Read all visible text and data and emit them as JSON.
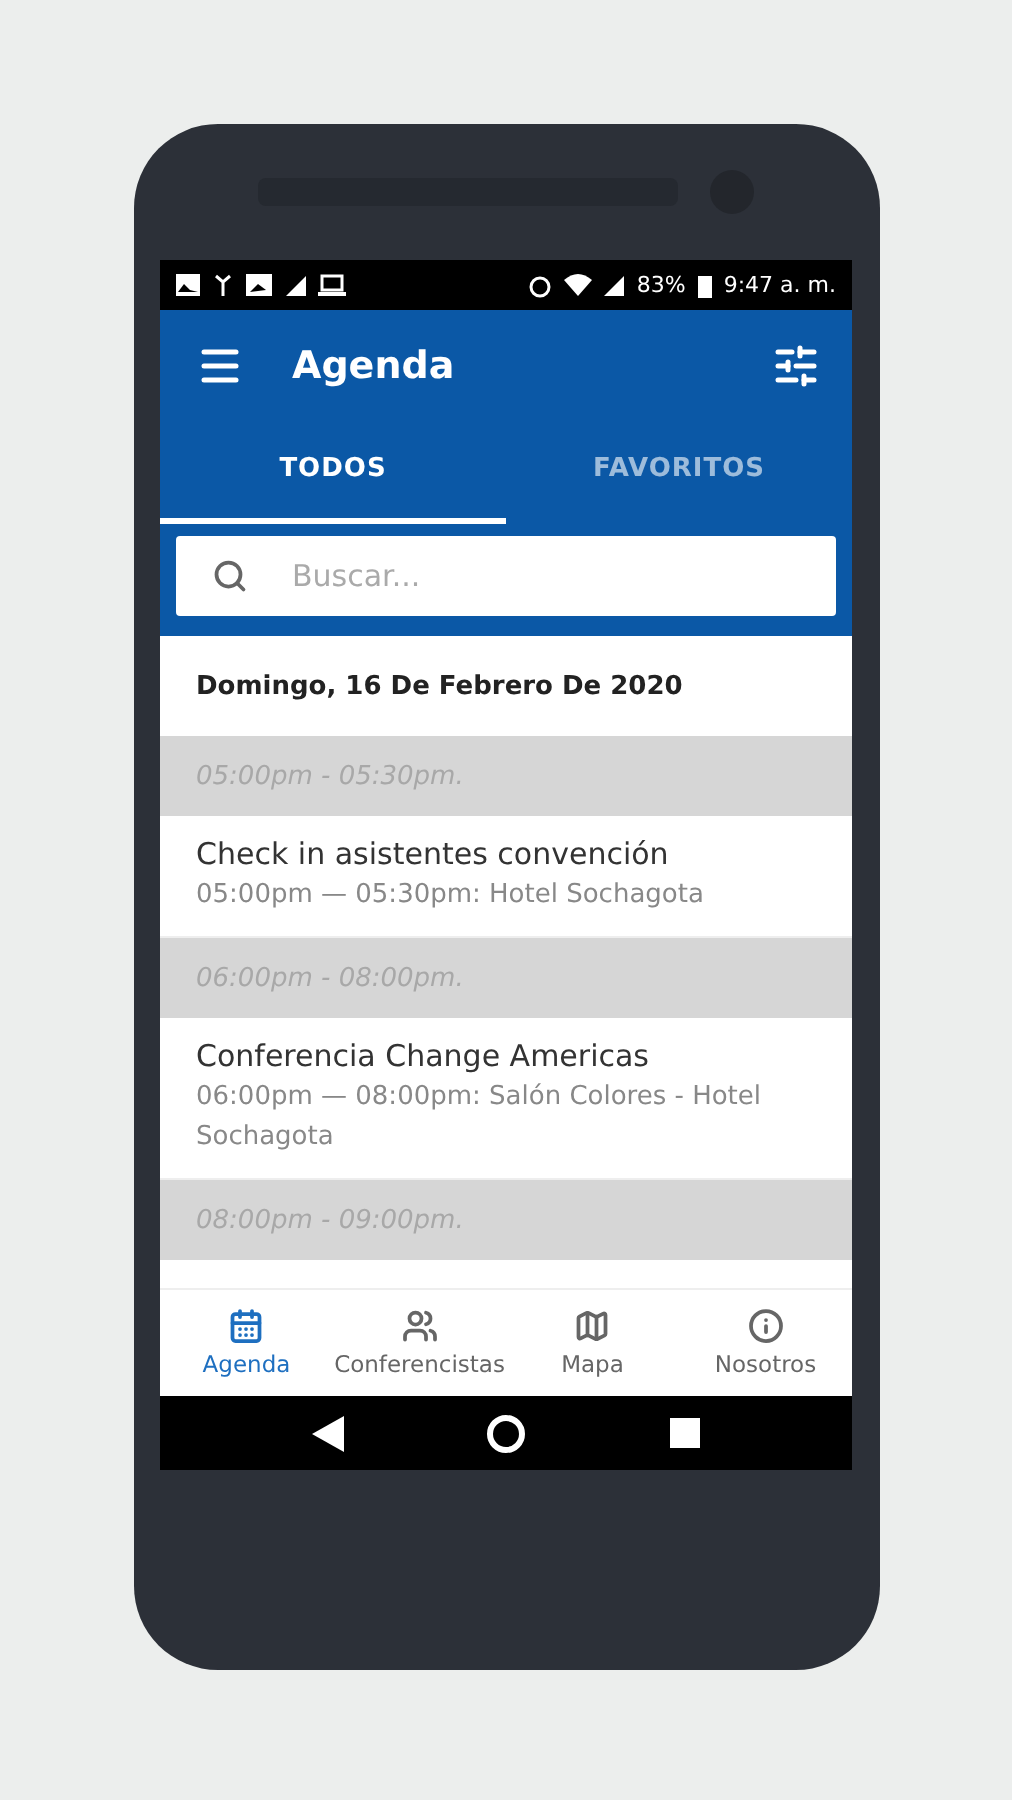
{
  "status_bar": {
    "battery": "83%",
    "time": "9:47 a. m."
  },
  "app_bar": {
    "title": "Agenda"
  },
  "tabs": [
    {
      "label": "TODOS",
      "selected": true
    },
    {
      "label": "FAVORITOS",
      "selected": false
    }
  ],
  "search": {
    "placeholder": "Buscar..."
  },
  "date": "Domingo, 16 De Febrero De 2020",
  "agenda": [
    {
      "kind": "time_header",
      "text": "05:00pm - 05:30pm."
    },
    {
      "kind": "event",
      "title": "Check in asistentes convención",
      "detail": "05:00pm — 05:30pm: Hotel Sochagota"
    },
    {
      "kind": "time_header",
      "text": "06:00pm - 08:00pm."
    },
    {
      "kind": "event",
      "title": "Conferencia Change Americas",
      "detail": "06:00pm — 08:00pm: Salón Colores - Hotel Sochagota"
    },
    {
      "kind": "time_header",
      "text": "08:00pm - 09:00pm."
    }
  ],
  "bottom_nav": [
    {
      "label": "Agenda",
      "selected": true
    },
    {
      "label": "Conferencistas",
      "selected": false
    },
    {
      "label": "Mapa",
      "selected": false
    },
    {
      "label": "Nosotros",
      "selected": false
    }
  ]
}
